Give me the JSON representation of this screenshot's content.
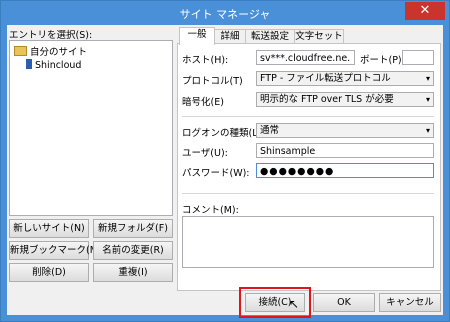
{
  "window": {
    "title": "サイト マネージャ",
    "close_glyph": "✕"
  },
  "left": {
    "entry_label": "エントリを選択(S):",
    "tree": [
      {
        "label": "自分のサイト",
        "icon": "folder-icon"
      },
      {
        "label": "Shincloud",
        "icon": "server-icon"
      }
    ],
    "buttons": {
      "new_site": "新しいサイト(N)",
      "new_folder": "新規フォルダ(F)",
      "new_bookmark": "新規ブックマーク(M)",
      "rename": "名前の変更(R)",
      "delete": "削除(D)",
      "duplicate": "重複(I)"
    }
  },
  "tabs": [
    "一般",
    "詳細",
    "転送設定",
    "文字セット"
  ],
  "general": {
    "host_label": "ホスト(H):",
    "host_value": "sv***.cloudfree.ne.",
    "port_label": "ポート(P):",
    "port_value": "",
    "protocol_label": "プロトコル(T)",
    "protocol_value": "FTP - ファイル転送プロトコル",
    "encryption_label": "暗号化(E)",
    "encryption_value": "明示的な FTP over TLS が必要",
    "logon_label": "ログオンの種類(L):",
    "logon_value": "通常",
    "user_label": "ユーザ(U):",
    "user_value": "Shinsample",
    "password_label": "パスワード(W):",
    "password_value": "●●●●●●●●",
    "comment_label": "コメント(M):",
    "comment_value": ""
  },
  "footer": {
    "connect": "接続(C)",
    "ok": "OK",
    "cancel": "キャンセル"
  },
  "colors": {
    "titlebar": "#4a90d9",
    "close": "#c9352c",
    "highlight": "#e0151b"
  }
}
